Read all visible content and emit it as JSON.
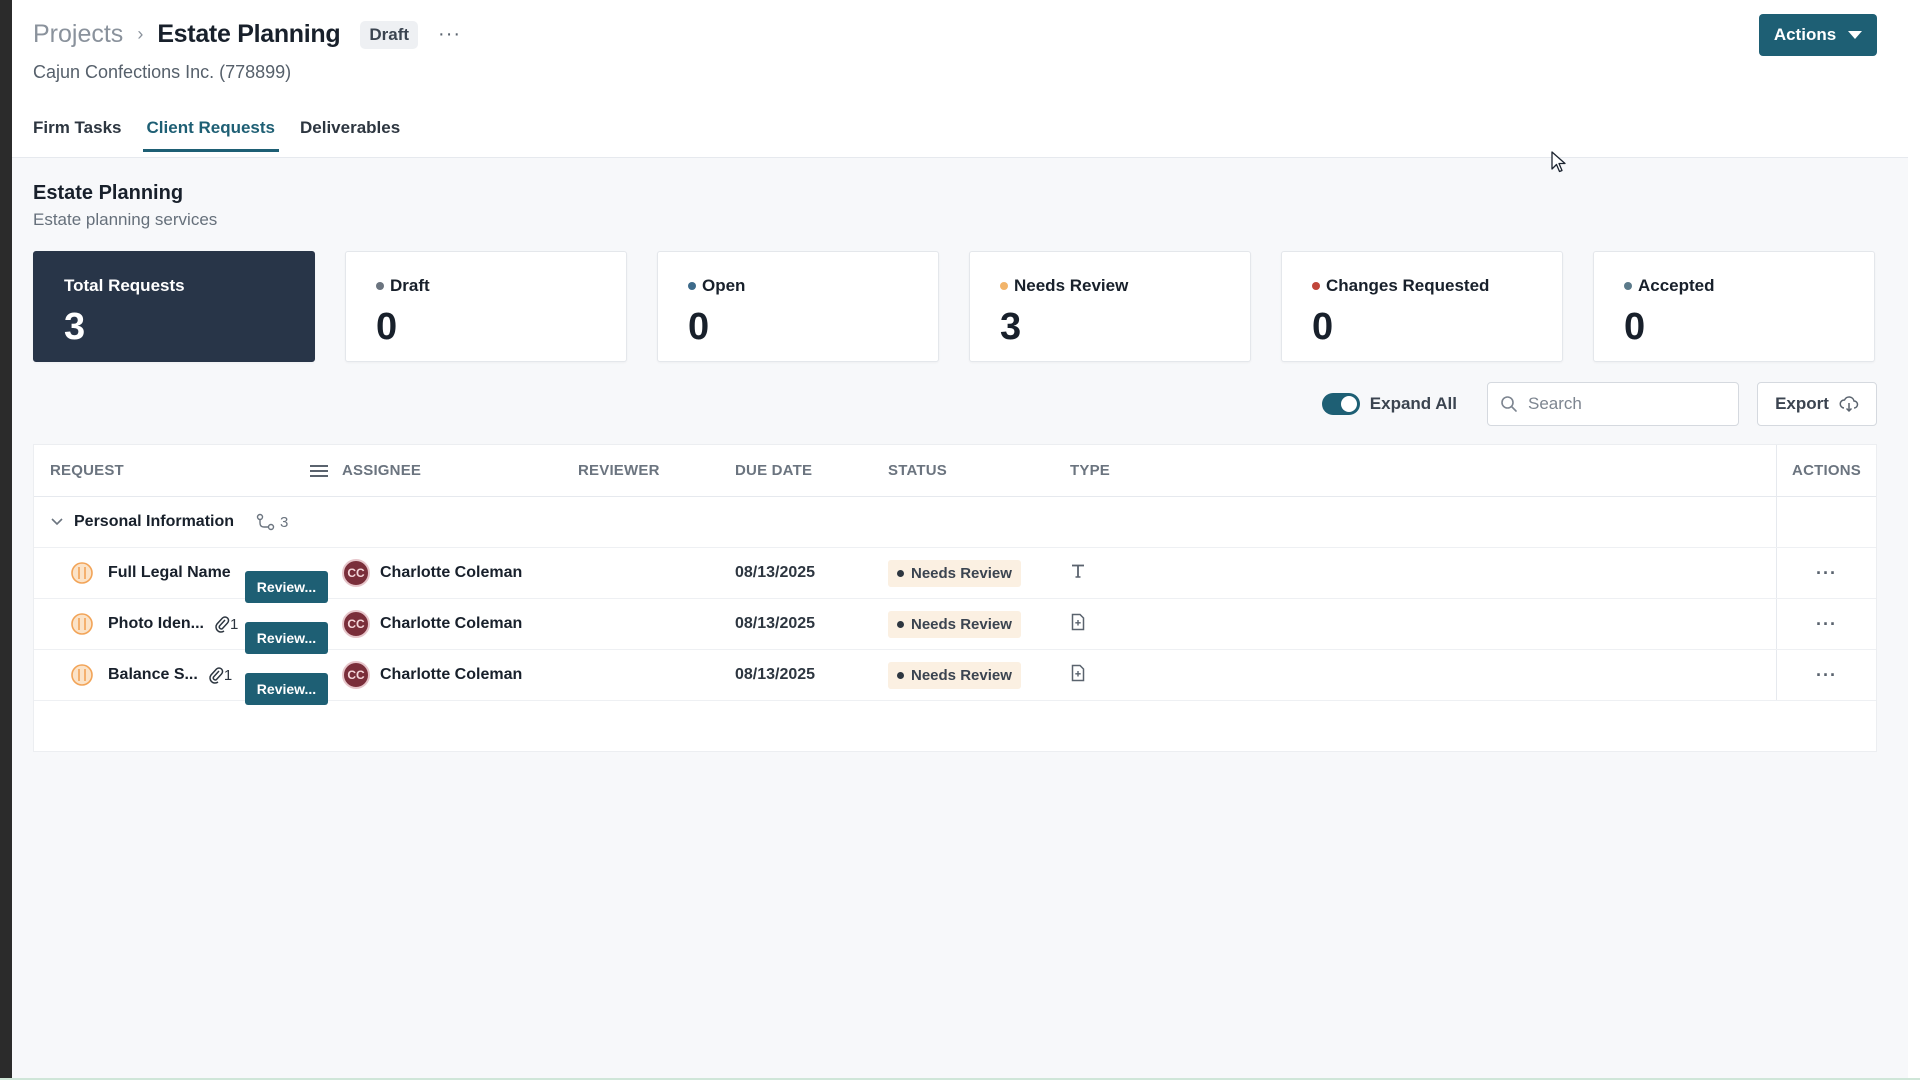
{
  "breadcrumb": {
    "root": "Projects",
    "separator": "›",
    "title": "Estate Planning",
    "badge": "Draft",
    "more": "···"
  },
  "client": "Cajun Confections Inc. (778899)",
  "header_actions": {
    "label": "Actions"
  },
  "tabs": [
    {
      "label": "Firm Tasks",
      "active": false
    },
    {
      "label": "Client Requests",
      "active": true
    },
    {
      "label": "Deliverables",
      "active": false
    }
  ],
  "section": {
    "title": "Estate Planning",
    "subtitle": "Estate planning services"
  },
  "cards": [
    {
      "label": "Total Requests",
      "value": "3",
      "dot_color": ""
    },
    {
      "label": "Draft",
      "value": "0",
      "dot_color": "#6b747f"
    },
    {
      "label": "Open",
      "value": "0",
      "dot_color": "#3d6a8a"
    },
    {
      "label": "Needs Review",
      "value": "3",
      "dot_color": "#f2b46a"
    },
    {
      "label": "Changes Requested",
      "value": "0",
      "dot_color": "#c0453a"
    },
    {
      "label": "Accepted",
      "value": "0",
      "dot_color": "#5b7a8a"
    }
  ],
  "toolbar": {
    "expand_all": "Expand All",
    "search_placeholder": "Search",
    "export": "Export"
  },
  "table": {
    "columns": {
      "request": "REQUEST",
      "assignee": "ASSIGNEE",
      "reviewer": "REVIEWER",
      "due_date": "DUE DATE",
      "status": "STATUS",
      "type": "TYPE",
      "actions": "ACTIONS"
    },
    "group": {
      "title": "Personal Information",
      "count": "3"
    },
    "rows": [
      {
        "name": "Full Legal Name",
        "attachments": "",
        "review": "Review...",
        "initials": "CC",
        "assignee": "Charlotte Coleman",
        "due": "08/13/2025",
        "status": "Needs Review",
        "type_icon": "text-type-icon",
        "more": "···"
      },
      {
        "name": "Photo Iden...",
        "attachments": "1",
        "review": "Review...",
        "initials": "CC",
        "assignee": "Charlotte Coleman",
        "due": "08/13/2025",
        "status": "Needs Review",
        "type_icon": "file-type-icon",
        "more": "···"
      },
      {
        "name": "Balance S...",
        "attachments": "1",
        "review": "Review...",
        "initials": "CC",
        "assignee": "Charlotte Coleman",
        "due": "08/13/2025",
        "status": "Needs Review",
        "type_icon": "file-type-icon",
        "more": "···"
      }
    ]
  },
  "colors": {
    "primary": "#1e5f74",
    "dark_card": "#283548",
    "status_bg": "#fbf0e2"
  }
}
